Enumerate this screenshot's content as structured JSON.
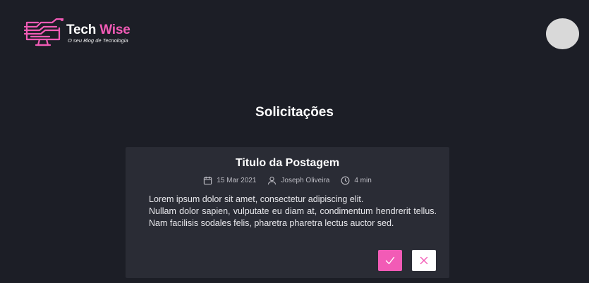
{
  "header": {
    "logo_title_part1": "Tech",
    "logo_title_part2": "Wise",
    "logo_subtitle": "O seu Blog de Tecnologia"
  },
  "page": {
    "title": "Solicitações"
  },
  "request": {
    "title": "Titulo da Postagem",
    "date": "15 Mar 2021",
    "author": "Joseph Oliveira",
    "read_time": "4 min",
    "body_line1": "Lorem ipsum dolor sit amet, consectetur adipiscing elit.",
    "body_line2": "Nullam dolor sapien, vulputate eu diam at, condimentum hendrerit tellus. Nam facilisis sodales felis, pharetra pharetra lectus auctor sed."
  },
  "colors": {
    "background": "#1c1e26",
    "card": "#2a2c35",
    "accent": "#f25bb6"
  },
  "icons": {
    "logo": "circuit-monitor-icon",
    "date": "calendar-icon",
    "author": "user-icon",
    "read_time": "clock-icon",
    "approve": "check-icon",
    "reject": "close-icon"
  }
}
